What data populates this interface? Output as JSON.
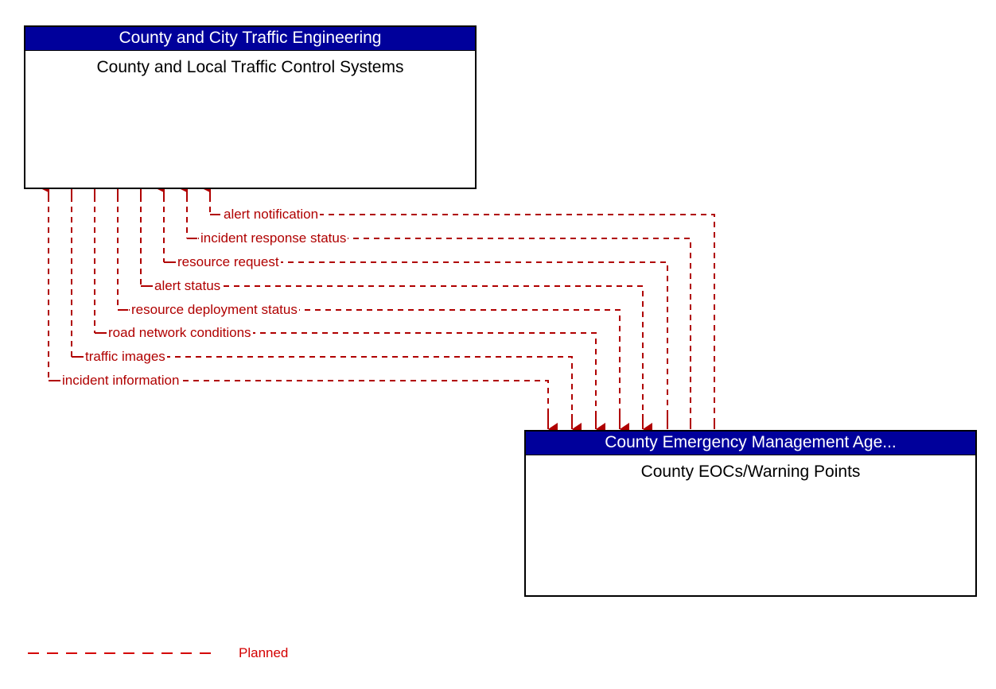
{
  "diagram": {
    "type": "flow",
    "nodes": [
      {
        "id": "top",
        "stakeholder": "County and City Traffic Engineering",
        "name": "County and Local Traffic Control Systems"
      },
      {
        "id": "bottom",
        "stakeholder": "County Emergency Management Age...",
        "name": "County EOCs/Warning Points"
      }
    ],
    "flows": [
      {
        "label": "alert notification",
        "direction": "bottom-to-top"
      },
      {
        "label": "incident response status",
        "direction": "bottom-to-top"
      },
      {
        "label": "resource request",
        "direction": "top-to-bottom"
      },
      {
        "label": "alert status",
        "direction": "top-to-bottom"
      },
      {
        "label": "resource deployment status",
        "direction": "bottom-to-top"
      },
      {
        "label": "road network conditions",
        "direction": "top-to-bottom"
      },
      {
        "label": "traffic images",
        "direction": "top-to-bottom"
      },
      {
        "label": "incident information",
        "direction": "top-to-bottom"
      }
    ],
    "legend": [
      {
        "label": "Planned",
        "style": "dashed",
        "color": "#D40000"
      }
    ],
    "colors": {
      "node_title_bg": "#00009B",
      "node_title_text": "#FFFFFF",
      "node_border": "#000000",
      "flow_line": "#B00000",
      "legend_line": "#D40000"
    }
  }
}
